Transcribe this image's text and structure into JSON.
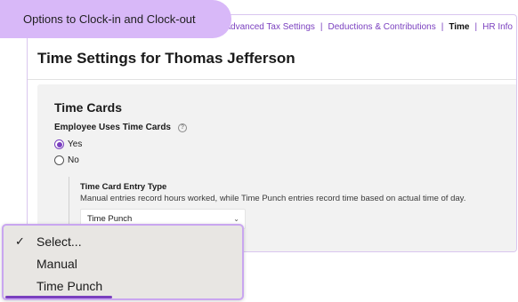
{
  "callout": {
    "text": "Options to Clock-in and Clock-out"
  },
  "tabs": [
    {
      "label": "Advanced Tax Settings"
    },
    {
      "label": "Deductions & Contributions"
    },
    {
      "label": "Time"
    },
    {
      "label": "HR Info"
    }
  ],
  "tab_separator": "|",
  "page": {
    "title": "Time Settings for Thomas Jefferson"
  },
  "time_cards": {
    "title": "Time Cards",
    "uses_label": "Employee Uses Time Cards",
    "help_icon": "question-circle-icon",
    "options": [
      {
        "label": "Yes",
        "checked": true
      },
      {
        "label": "No",
        "checked": false
      }
    ],
    "entry_type": {
      "title": "Time Card Entry Type",
      "description": "Manual entries record hours worked, while Time Punch entries record time based on actual time of day.",
      "selected": "Time Punch"
    }
  },
  "dropdown": {
    "options": [
      {
        "label": "Select...",
        "checked": true
      },
      {
        "label": "Manual",
        "checked": false
      },
      {
        "label": "Time Punch",
        "checked": false
      }
    ]
  },
  "colors": {
    "accent": "#7a3fbf",
    "callout_bg": "#d8b8f8",
    "panel_bg": "#f2f2f2"
  }
}
